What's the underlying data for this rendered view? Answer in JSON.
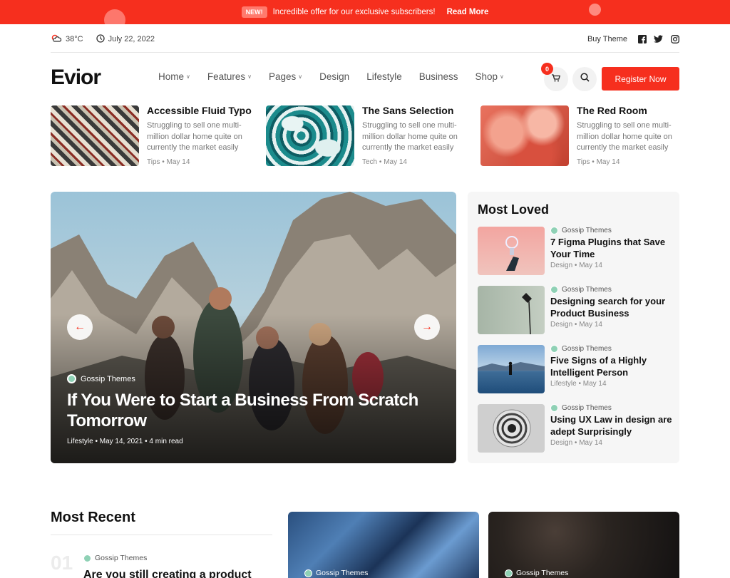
{
  "promo": {
    "badge": "NEW!",
    "text": "Incredible offer for our exclusive subscribers!",
    "link": "Read More"
  },
  "utility": {
    "weather": "38°C",
    "date": "July 22, 2022",
    "buy": "Buy Theme",
    "social": [
      "facebook-icon",
      "twitter-icon",
      "instagram-icon"
    ]
  },
  "header": {
    "logo": "Evior",
    "nav": [
      {
        "label": "Home",
        "dropdown": true
      },
      {
        "label": "Features",
        "dropdown": true
      },
      {
        "label": "Pages",
        "dropdown": true
      },
      {
        "label": "Design",
        "dropdown": false
      },
      {
        "label": "Lifestyle",
        "dropdown": false
      },
      {
        "label": "Business",
        "dropdown": false
      },
      {
        "label": "Shop",
        "dropdown": true
      }
    ],
    "cart_count": "0",
    "register": "Register Now"
  },
  "mini_posts": [
    {
      "title": "Accessible Fluid Typo",
      "desc": "Struggling to sell one multi-million dollar home quite on currently the market easily",
      "category": "Tips",
      "date": "May 14"
    },
    {
      "title": "The Sans Selection",
      "desc": "Struggling to sell one multi-million dollar home quite on currently the market easily",
      "category": "Tech",
      "date": "May 14"
    },
    {
      "title": "The Red Room",
      "desc": "Struggling to sell one multi-million dollar home quite on currently the market easily",
      "category": "Tips",
      "date": "May 14"
    }
  ],
  "hero": {
    "author": "Gossip Themes",
    "title": "If You Were to Start a Business From Scratch Tomorrow",
    "category": "Lifestyle",
    "date": "May 14, 2021",
    "read": "4 min read"
  },
  "most_loved": {
    "heading": "Most Loved",
    "items": [
      {
        "author": "Gossip Themes",
        "title": "7 Figma Plugins that Save Your Time",
        "category": "Design",
        "date": "May 14"
      },
      {
        "author": "Gossip Themes",
        "title": "Designing search for your Product Business",
        "category": "Design",
        "date": "May 14"
      },
      {
        "author": "Gossip Themes",
        "title": "Five Signs of a Highly Intelligent Person",
        "category": "Lifestyle",
        "date": "May 14"
      },
      {
        "author": "Gossip Themes",
        "title": "Using UX Law in design are adept Surprisingly",
        "category": "Design",
        "date": "May 14"
      }
    ]
  },
  "most_recent": {
    "heading": "Most Recent",
    "number": "01",
    "author": "Gossip Themes",
    "title": "Are you still creating a product",
    "cards": [
      {
        "author": "Gossip Themes"
      },
      {
        "author": "Gossip Themes"
      }
    ]
  },
  "colors": {
    "accent": "#f62f1e"
  }
}
